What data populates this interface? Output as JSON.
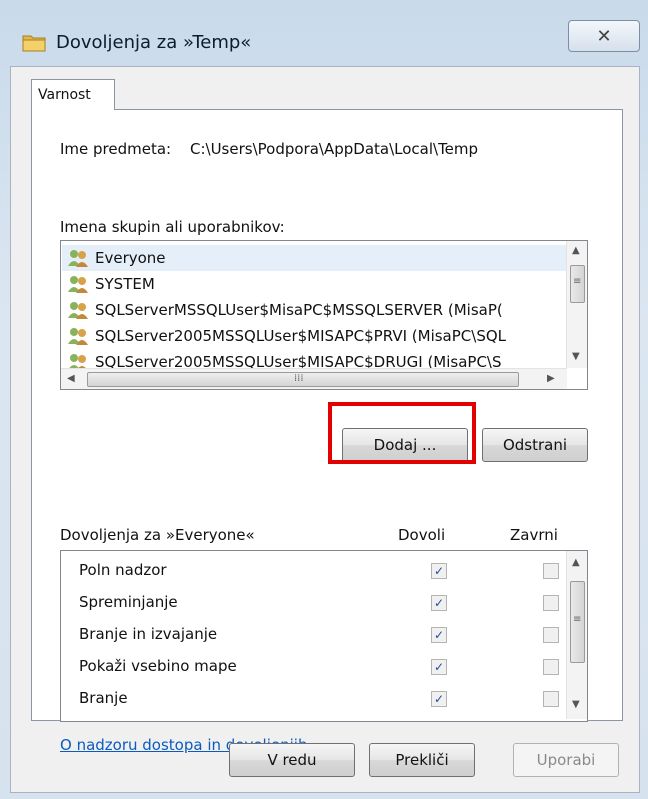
{
  "window": {
    "title": "Dovoljenja za »Temp«",
    "close_glyph": "✕"
  },
  "tabs": [
    {
      "label": "Varnost",
      "selected": true
    }
  ],
  "object": {
    "label": "Ime predmeta:",
    "value": "C:\\Users\\Podpora\\AppData\\Local\\Temp"
  },
  "groups": {
    "label": "Imena skupin ali uporabnikov:",
    "items": [
      {
        "name": "Everyone",
        "selected": true
      },
      {
        "name": "SYSTEM",
        "selected": false
      },
      {
        "name": "SQLServerMSSQLUser$MisaPC$MSSQLSERVER (MisaP(",
        "selected": false
      },
      {
        "name": "SQLServer2005MSSQLUser$MISAPC$PRVI (MisaPC\\SQL",
        "selected": false
      },
      {
        "name": "SQLServer2005MSSQLUser$MISAPC$DRUGI (MisaPC\\S",
        "selected": false
      }
    ],
    "add_button": "Dodaj ...",
    "remove_button": "Odstrani"
  },
  "permissions": {
    "label": "Dovoljenja za »Everyone«",
    "allow_header": "Dovoli",
    "deny_header": "Zavrni",
    "rows": [
      {
        "name": "Poln nadzor",
        "allow": true,
        "deny": false
      },
      {
        "name": "Spreminjanje",
        "allow": true,
        "deny": false
      },
      {
        "name": "Branje in izvajanje",
        "allow": true,
        "deny": false
      },
      {
        "name": "Pokaži vsebino mape",
        "allow": true,
        "deny": false
      },
      {
        "name": "Branje",
        "allow": true,
        "deny": false
      }
    ]
  },
  "help_link": "O nadzoru dostopa in dovoljenjih",
  "footer": {
    "ok": "V redu",
    "cancel": "Prekliči",
    "apply": "Uporabi"
  },
  "colors": {
    "highlight": "#e20000",
    "link": "#0b5bbf",
    "check": "#1c4fa0"
  }
}
